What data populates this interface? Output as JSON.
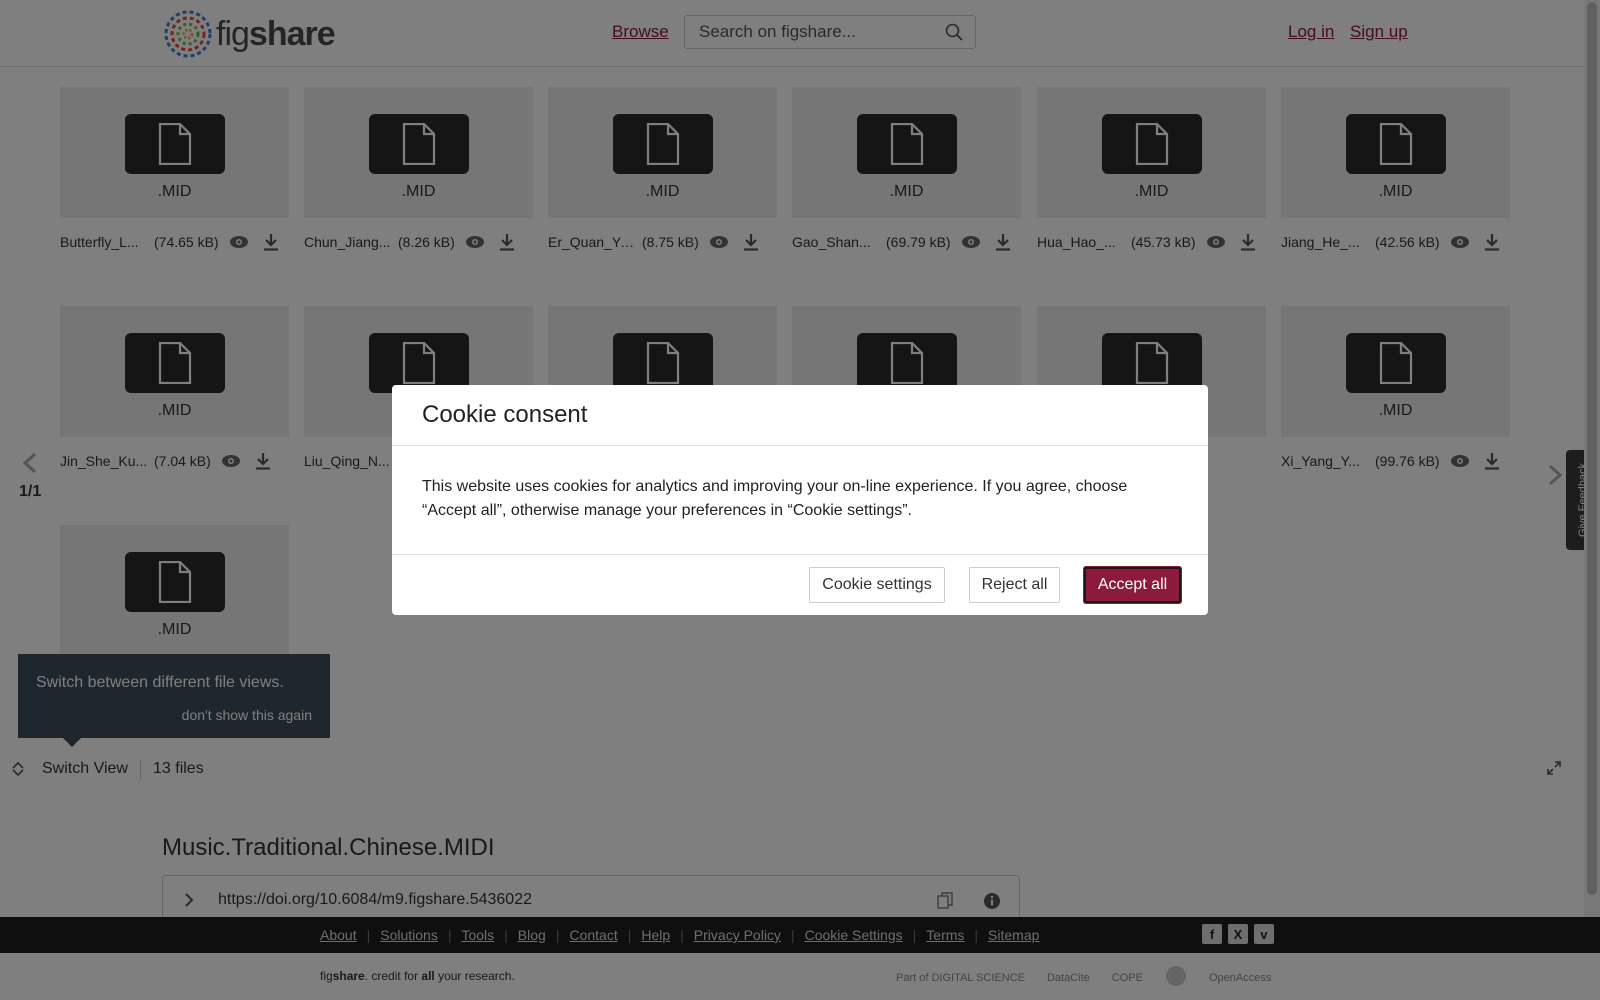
{
  "header": {
    "logo_text_fig": "fig",
    "logo_text_share": "share",
    "browse_label": "Browse",
    "search_placeholder": "Search on figshare...",
    "login_label": "Log in",
    "signup_label": "Sign up"
  },
  "files": [
    {
      "name": "Butterfly_L...",
      "size": "(74.65 kB)",
      "ext": ".MID"
    },
    {
      "name": "Chun_Jiang...",
      "size": "(8.26 kB)",
      "ext": ".MID"
    },
    {
      "name": "Er_Quan_Ya...",
      "size": "(8.75 kB)",
      "ext": ".MID"
    },
    {
      "name": "Gao_Shan...",
      "size": "(69.79 kB)",
      "ext": ".MID"
    },
    {
      "name": "Hua_Hao_...",
      "size": "(45.73 kB)",
      "ext": ".MID"
    },
    {
      "name": "Jiang_He_...",
      "size": "(42.56 kB)",
      "ext": ".MID"
    },
    {
      "name": "Jin_She_Ku...",
      "size": "(7.04 kB)",
      "ext": ".MID"
    },
    {
      "name": "Liu_Qing_N...",
      "size": "",
      "ext": ""
    },
    {
      "name": "",
      "size": "",
      "ext": ""
    },
    {
      "name": "",
      "size": "",
      "ext": ""
    },
    {
      "name": "",
      "size": "",
      "ext": ""
    },
    {
      "name": "Xi_Yang_Y...",
      "size": "(99.76 kB)",
      "ext": ".MID"
    },
    {
      "name": "",
      "size": "",
      "ext": ".MID"
    }
  ],
  "viewer": {
    "page_indicator": "1/1",
    "tooltip_text": "Switch between different file views.",
    "tooltip_dismiss": "don't show this again",
    "switch_view_label": "Switch View",
    "file_count": "13 files"
  },
  "item": {
    "title": "Music.Traditional.Chinese.MIDI",
    "doi": "https://doi.org/10.6084/m9.figshare.5436022"
  },
  "footer": {
    "links": [
      "About",
      "Solutions",
      "Tools",
      "Blog",
      "Contact",
      "Help",
      "Privacy Policy",
      "Cookie Settings",
      "Terms",
      "Sitemap"
    ],
    "social": [
      "f",
      "X",
      "v"
    ],
    "tagline_fig": "fig",
    "tagline_share": "share",
    "tagline_mid": ". credit for ",
    "tagline_all": "all",
    "tagline_end": " your research.",
    "partners": [
      "Part of DIGITAL SCIENCE",
      "DataCite",
      "COPE",
      "OpenAccess"
    ]
  },
  "feedback_label": "Give Feedback",
  "cookie_modal": {
    "title": "Cookie consent",
    "text": "This website uses cookies for analytics and improving your on-line experience. If you agree, choose “Accept all”, otherwise manage your preferences in “Cookie settings”.",
    "settings_label": "Cookie settings",
    "reject_label": "Reject all",
    "accept_label": "Accept all"
  },
  "colors": {
    "brand": "#8b1a3d",
    "tooltip_bg": "#3d4e5c",
    "footer_bg": "#1f1f1f"
  }
}
